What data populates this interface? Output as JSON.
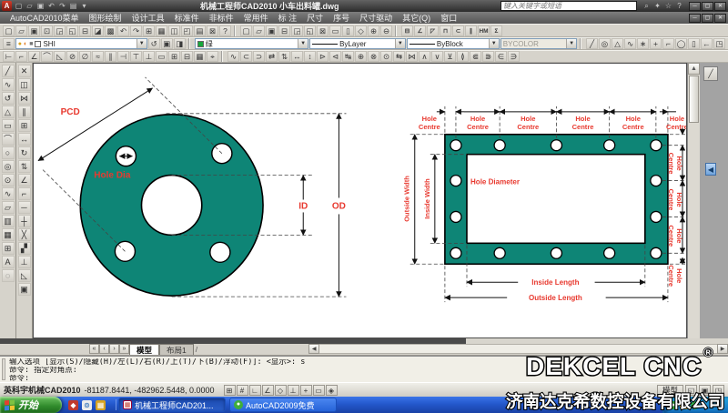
{
  "window": {
    "logo": "A",
    "quick_icons": [
      "▢",
      "▱",
      "▣",
      "↶",
      "↷",
      "▤",
      "▾"
    ],
    "title": "机械工程师CAD2010  小车出料罐.dwg",
    "search_placeholder": "键入关键字或短语",
    "info_icons": [
      "⌕",
      "✦",
      "☆",
      "?"
    ],
    "min": "─",
    "max": "▢",
    "close": "✕"
  },
  "menu": {
    "items": [
      "AutoCAD2010菜单",
      "图形绘制",
      "设计工具",
      "标准件",
      "非标件",
      "常用件",
      "标 注",
      "尺寸",
      "序号",
      "尺寸驱动",
      "其它(Q)",
      "窗口"
    ]
  },
  "toolbar1": {
    "group1": [
      "▢",
      "▱",
      "▣",
      "⊡",
      "◲",
      "◱",
      "⊟",
      "◪",
      "▩",
      "↶",
      "↷",
      "⊞",
      "▦",
      "◫",
      "◰",
      "▤",
      "⊠",
      "?"
    ],
    "group2": [
      "▢",
      "▱",
      "▣",
      "⊟",
      "◲",
      "◱",
      "⊠",
      "▭",
      "▯",
      "◇",
      "⊕",
      "⊖"
    ],
    "group3": [
      "⊟",
      "∠",
      "◸",
      "⊓",
      "⊂",
      "∥",
      "HM",
      "Σ"
    ]
  },
  "toolbar2": {
    "layers_icon": "≡",
    "layer_swatches": [
      "●",
      "◐",
      "■",
      "□"
    ],
    "layer_value": "SHI",
    "layer_btns": [
      "↺",
      "▣",
      "◨"
    ],
    "color_value": "绿",
    "color_hex": "#18a83c",
    "linetype_value": "ByLayer",
    "lineweight_value": "ByBlock",
    "plotstyle_value": "BYCOLOR",
    "draw_icons": [
      "╱",
      "◎",
      "△",
      "∿",
      "∗",
      "+",
      "⌐",
      "◯",
      "▯",
      "←",
      "◳"
    ]
  },
  "toolbar3": {
    "group1": [
      "⊢",
      "⌐",
      "∠",
      "⌒",
      "◺",
      "⊘",
      "∅",
      "≈",
      "∥",
      "⊣",
      "⊤",
      "⊥",
      "▭",
      "⊞",
      "⊟",
      "▦",
      "⌖"
    ],
    "group2": [
      "∿",
      "⊂",
      "⊃",
      "⇄",
      "⇅",
      "↔",
      "↕",
      "⊳",
      "⊲",
      "↹",
      "⊕",
      "⊗",
      "⊙",
      "⇆",
      "⋈",
      "∧",
      "∨",
      "⊻",
      "≬",
      "⋐",
      "⋑",
      "∈",
      "∋"
    ]
  },
  "side_tools": {
    "col1": [
      "╱",
      "∿",
      "↺",
      "△",
      "▭",
      "⌒",
      "○",
      "◎",
      "⊙",
      "∿",
      "▱",
      "▥",
      "▦",
      "⊞",
      "A",
      "◌"
    ],
    "col2": [
      "✕",
      "◫",
      "⋈",
      "∥",
      "⊞",
      "↔",
      "↻",
      "⇅",
      "∠",
      "⌐",
      "─",
      "┼",
      "╳",
      "▞",
      "⊥",
      "◺",
      "▣"
    ]
  },
  "canvas_extras": {
    "pencil_btn": "╱",
    "blue_tag": "◀",
    "vscroll_up": "▲"
  },
  "drawing": {
    "gasket_color": "#0e8576",
    "label_color": "#e8392f",
    "circular": {
      "pcd": "PCD",
      "hole_dia": "Hole Dia",
      "id": "ID",
      "od": "OD"
    },
    "rect": {
      "hole_centre_1": "Hole",
      "hole_centre_2": "Centre",
      "outside_width": "Outside Width",
      "inside_width": "Inside Width",
      "hole_diameter": "Hole Diameter",
      "inside_length": "Inside Length",
      "outside_length": "Outside Length"
    }
  },
  "tabs": {
    "nav": [
      "«",
      "‹",
      "›",
      "»"
    ],
    "model": "模型",
    "layout": "布局1",
    "slash": "/",
    "hscroll_left": "◀",
    "hscroll_right": "▶"
  },
  "command": {
    "lines": [
      "输入选项 [显示(S)/隐藏(H)/左(L)/右(R)/上(T)/下(B)/浮动(F)]:  <显示>: s",
      "命令: 指定对角点:",
      "命令:"
    ]
  },
  "status": {
    "app": "英科宇机械CAD2010",
    "coords": "-81187.8441, -482962.5448, 0.0000",
    "toggles": [
      "⊞",
      "#",
      "∟",
      "∠",
      "◇",
      "⊥",
      "+",
      "▭",
      "◈"
    ],
    "model_btn": "模型",
    "right_icons": [
      "◱",
      "▣",
      "◳"
    ]
  },
  "taskbar": {
    "start": "开始",
    "quick": [
      "◆",
      "⊚",
      "▦"
    ],
    "tasks": [
      {
        "label": "机械工程师CAD201...",
        "icon": "▦"
      },
      {
        "label": "AutoCAD2009免费",
        "icon": "●"
      }
    ],
    "tray_icons": [
      "●",
      "◆",
      "▲"
    ]
  },
  "watermark": {
    "brand": "DEKCEL CNC",
    "reg": "®",
    "company": "济南达克希数控设备有限公司"
  }
}
